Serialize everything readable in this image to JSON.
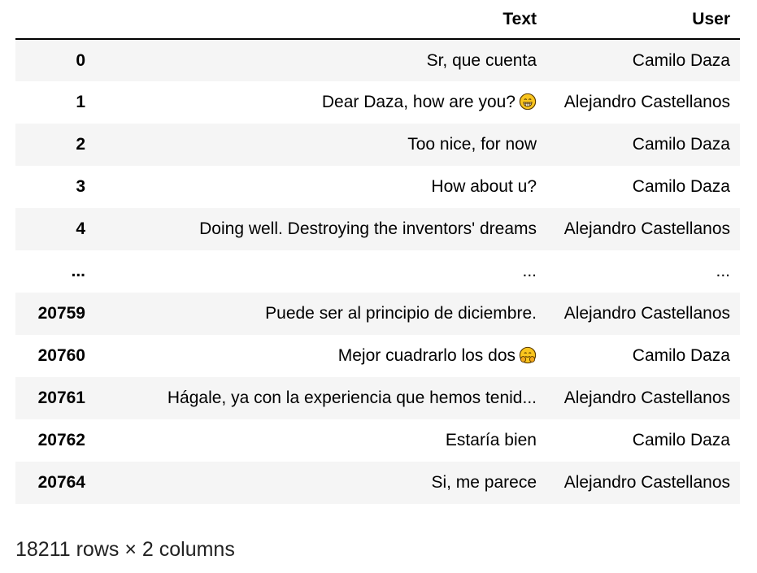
{
  "table": {
    "columns": [
      "",
      "Text",
      "User"
    ],
    "rows": [
      {
        "index": "0",
        "text": "Sr, que cuenta",
        "user": "Camilo Daza",
        "emoji": ""
      },
      {
        "index": "1",
        "text": "Dear Daza, how are you?",
        "user": "Alejandro Castellanos",
        "emoji": "grinning-face-emoji"
      },
      {
        "index": "2",
        "text": "Too nice, for now",
        "user": "Camilo Daza",
        "emoji": ""
      },
      {
        "index": "3",
        "text": "How about u?",
        "user": "Camilo Daza",
        "emoji": ""
      },
      {
        "index": "4",
        "text": "Doing well. Destroying the inventors' dreams",
        "user": "Alejandro Castellanos",
        "emoji": ""
      },
      {
        "index": "...",
        "text": "...",
        "user": "...",
        "emoji": ""
      },
      {
        "index": "20759",
        "text": "Puede ser al principio de diciembre.",
        "user": "Alejandro Castellanos",
        "emoji": ""
      },
      {
        "index": "20760",
        "text": "Mejor cuadrarlo los dos",
        "user": "Camilo Daza",
        "emoji": "hugging-face-emoji"
      },
      {
        "index": "20761",
        "text": "Hágale, ya con la experiencia que hemos tenid...",
        "user": "Alejandro Castellanos",
        "emoji": ""
      },
      {
        "index": "20762",
        "text": "Estaría bien",
        "user": "Camilo Daza",
        "emoji": ""
      },
      {
        "index": "20764",
        "text": "Si, me parece",
        "user": "Alejandro Castellanos",
        "emoji": ""
      }
    ]
  },
  "shape_caption": "18211 rows × 2 columns",
  "colors": {
    "row_stripe": "#f5f5f5",
    "emoji_yellow": "#f9c51e",
    "emoji_outline": "#5a3a00"
  }
}
